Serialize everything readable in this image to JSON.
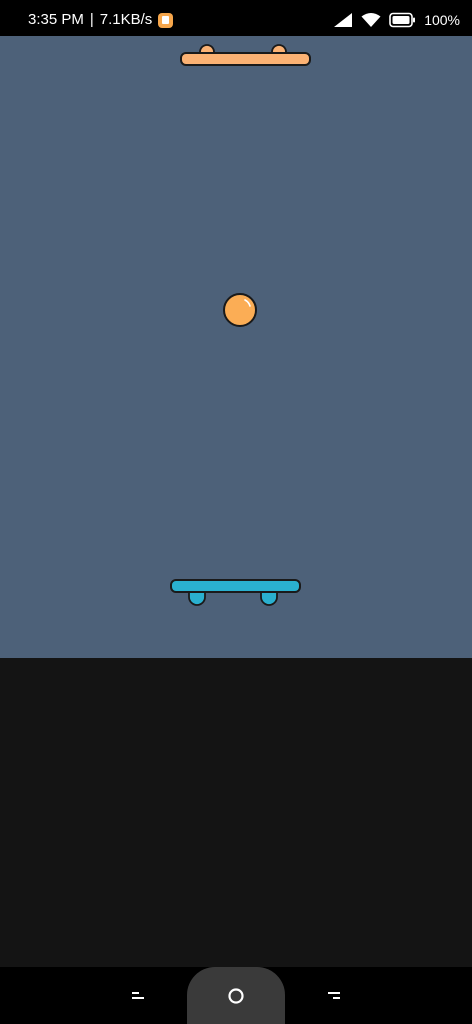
{
  "status_bar": {
    "time": "3:35 PM",
    "separator": "|",
    "network_speed": "7.1KB/s",
    "battery_percent": "100%",
    "app_badge_icon": "shopping-bag-icon",
    "signal_icon": "cell-signal-icon",
    "wifi_icon": "wifi-icon",
    "battery_icon": "battery-icon"
  },
  "game": {
    "background_color": "#4d6179",
    "top_paddle_color": "#fbb274",
    "bottom_paddle_color": "#2ab0cf",
    "ball_color": "#fbad55",
    "outline_color": "#1a1a1a"
  },
  "nav_bar": {
    "recents_icon": "menu-lines-icon",
    "home_icon": "circle-home-icon",
    "back_icon": "back-lines-icon"
  }
}
